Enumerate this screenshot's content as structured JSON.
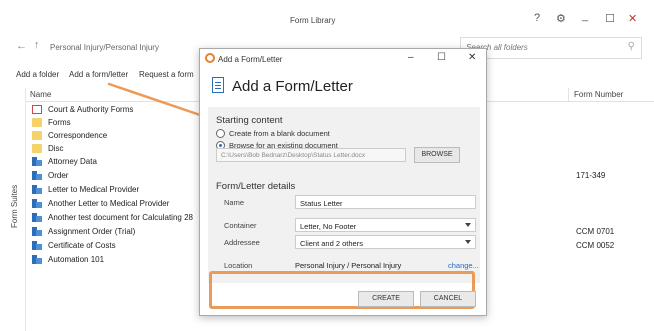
{
  "window": {
    "title": "Form Library",
    "help": "?",
    "gear": "⚙",
    "minimize": "_",
    "maximize": "☐",
    "close": "✕"
  },
  "nav": {
    "back": "←",
    "up": "↑",
    "path": "Personal Injury/Personal Injury",
    "search_placeholder": "Search all folders",
    "search_icon": "⚲"
  },
  "toolbar": {
    "add_folder": "Add a folder",
    "add_form": "Add a form/letter",
    "request_form": "Request a form"
  },
  "list": {
    "col_name": "Name",
    "col_form_number": "Form Number",
    "side_label": "Form Suites",
    "rows": [
      {
        "icon": "court-icon",
        "label": "Court & Authority Forms",
        "number": ""
      },
      {
        "icon": "folder-icon",
        "label": "Forms",
        "number": ""
      },
      {
        "icon": "folder-icon",
        "label": "Correspondence",
        "number": ""
      },
      {
        "icon": "folder-icon",
        "label": "Disc",
        "number": ""
      },
      {
        "icon": "document-icon",
        "label": "Attorney Data",
        "number": ""
      },
      {
        "icon": "document-icon",
        "label": "Order",
        "number": "171-349"
      },
      {
        "icon": "document-icon",
        "label": "Letter to Medical Provider",
        "number": ""
      },
      {
        "icon": "document-icon",
        "label": "Another Letter to Medical Provider",
        "number": ""
      },
      {
        "icon": "document-icon",
        "label": "Another test document for Calculating 28",
        "number": ""
      },
      {
        "icon": "document-icon",
        "label": "Assignment Order (Trial)",
        "number": "CCM 0701"
      },
      {
        "icon": "document-icon",
        "label": "Certificate of Costs",
        "number": "CCM 0052"
      },
      {
        "icon": "document-icon",
        "label": "Automation 101",
        "number": ""
      }
    ]
  },
  "dialog": {
    "title": "Add a Form/Letter",
    "minimize": "–",
    "maximize": "☐",
    "close": "✕",
    "heading": "Add a Form/Letter",
    "starting_content": "Starting content",
    "option_blank": "Create from a blank document",
    "option_existing": "Browse for an existing document",
    "path_value": "C:\\Users\\Bob Bednarz\\Desktop\\Status Letter.docx",
    "browse": "BROWSE",
    "details_title": "Form/Letter details",
    "name_label": "Name",
    "name_value": "Status Letter",
    "container_label": "Container",
    "container_value": "Letter, No Footer",
    "addressee_label": "Addressee",
    "addressee_value": "Client and 2 others",
    "location_label": "Location",
    "location_value": "Personal Injury / Personal Injury",
    "change": "change...",
    "create": "CREATE",
    "cancel": "CANCEL"
  },
  "colors": {
    "accent": "#2d6db5",
    "annotation": "#ec9a57",
    "close_red": "#c0392b"
  }
}
